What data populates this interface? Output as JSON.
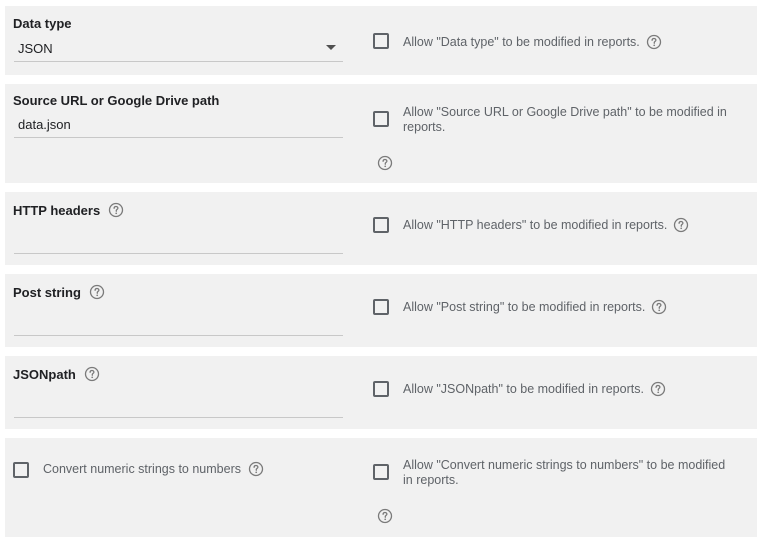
{
  "data_type": {
    "label": "Data type",
    "value": "JSON",
    "allow_text": "Allow \"Data type\" to be modified in reports."
  },
  "source_url": {
    "label": "Source URL or Google Drive path",
    "value": "data.json",
    "allow_text": "Allow \"Source URL or Google Drive path\" to be modified in reports."
  },
  "http_headers": {
    "label": "HTTP headers",
    "value": "",
    "allow_text": "Allow \"HTTP headers\" to be modified in reports."
  },
  "post_string": {
    "label": "Post string",
    "value": "",
    "allow_text": "Allow \"Post string\" to be modified in reports."
  },
  "jsonpath": {
    "label": "JSONpath",
    "value": "",
    "allow_text": "Allow \"JSONpath\" to be modified in reports."
  },
  "convert_numeric": {
    "label": "Convert numeric strings to numbers",
    "checked": false,
    "allow_text": "Allow \"Convert numeric strings to numbers\" to be modified in reports."
  },
  "icons": {
    "help": "help-circle-icon",
    "dropdown": "dropdown-arrow-icon"
  },
  "colors": {
    "panel_bg": "#f1f1f1",
    "text": "#202124",
    "secondary_text": "#5f6368",
    "underline": "#c8c8c8"
  }
}
